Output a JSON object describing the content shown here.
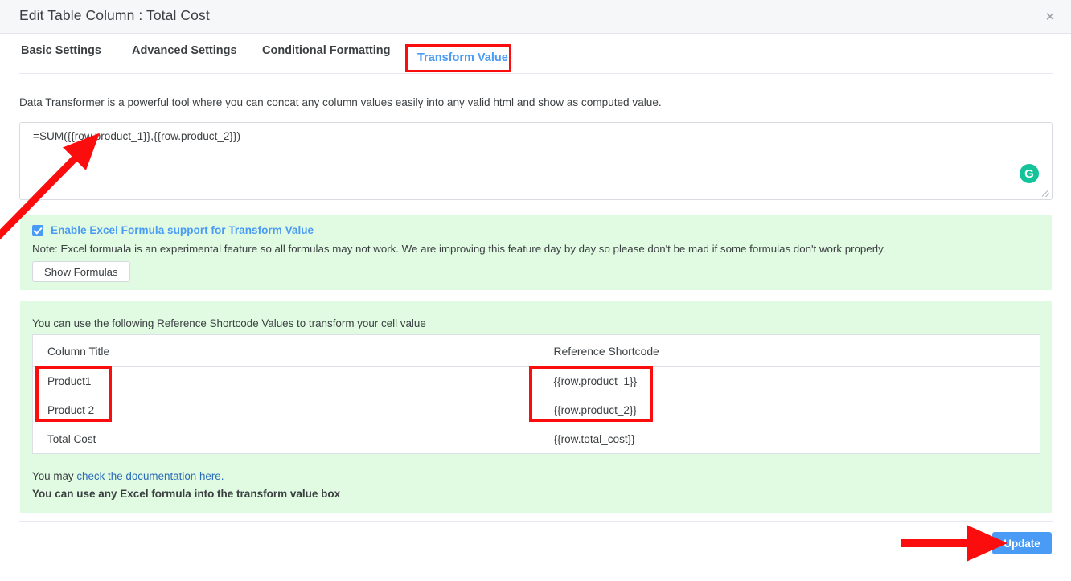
{
  "header": {
    "title": "Edit Table Column : Total Cost",
    "close_icon": "close-icon",
    "close_glyph": "✕"
  },
  "tabs": [
    {
      "label": "Basic Settings",
      "active": false
    },
    {
      "label": "Advanced Settings",
      "active": false
    },
    {
      "label": "Conditional Formatting",
      "active": false
    },
    {
      "label": "Transform Value",
      "active": true
    }
  ],
  "main": {
    "description": "Data Transformer is a powerful tool where you can concat any column values easily into any valid html and show as computed value.",
    "formula_value": "=SUM({{row.product_1}},{{row.product_2}})",
    "formula_placeholder": "",
    "grammarly_icon": "grammarly-icon",
    "grammarly_glyph": "G"
  },
  "excel_panel": {
    "checkbox_label": "Enable Excel Formula support for Transform Value",
    "checkbox_checked": true,
    "note": "Note: Excel formuala is an experimental feature so all formulas may not work. We are improving this feature day by day so please don't be mad if some formulas don't work properly.",
    "show_formulas_label": "Show Formulas"
  },
  "shortcode_panel": {
    "intro": "You can use the following Reference Shortcode Values to transform your cell value",
    "table": {
      "headers": [
        "Column Title",
        "Reference Shortcode"
      ],
      "rows": [
        {
          "title": "Product1",
          "code": "{{row.product_1}}"
        },
        {
          "title": "Product 2",
          "code": "{{row.product_2}}"
        },
        {
          "title": "Total Cost",
          "code": "{{row.total_cost}}"
        }
      ]
    },
    "doc_prefix": "You may ",
    "doc_link": "check the documentation here.",
    "bold_line": "You can use any Excel formula into the transform value box"
  },
  "footer": {
    "update_label": "Update"
  },
  "colors": {
    "accent_blue": "#4a9bf5",
    "annotation_red": "#fc0d0d",
    "panel_green": "#e0fbe1",
    "header_gray": "#f6f7f8",
    "grammarly_green": "#15c39a",
    "link_blue": "#2b6cb8"
  }
}
